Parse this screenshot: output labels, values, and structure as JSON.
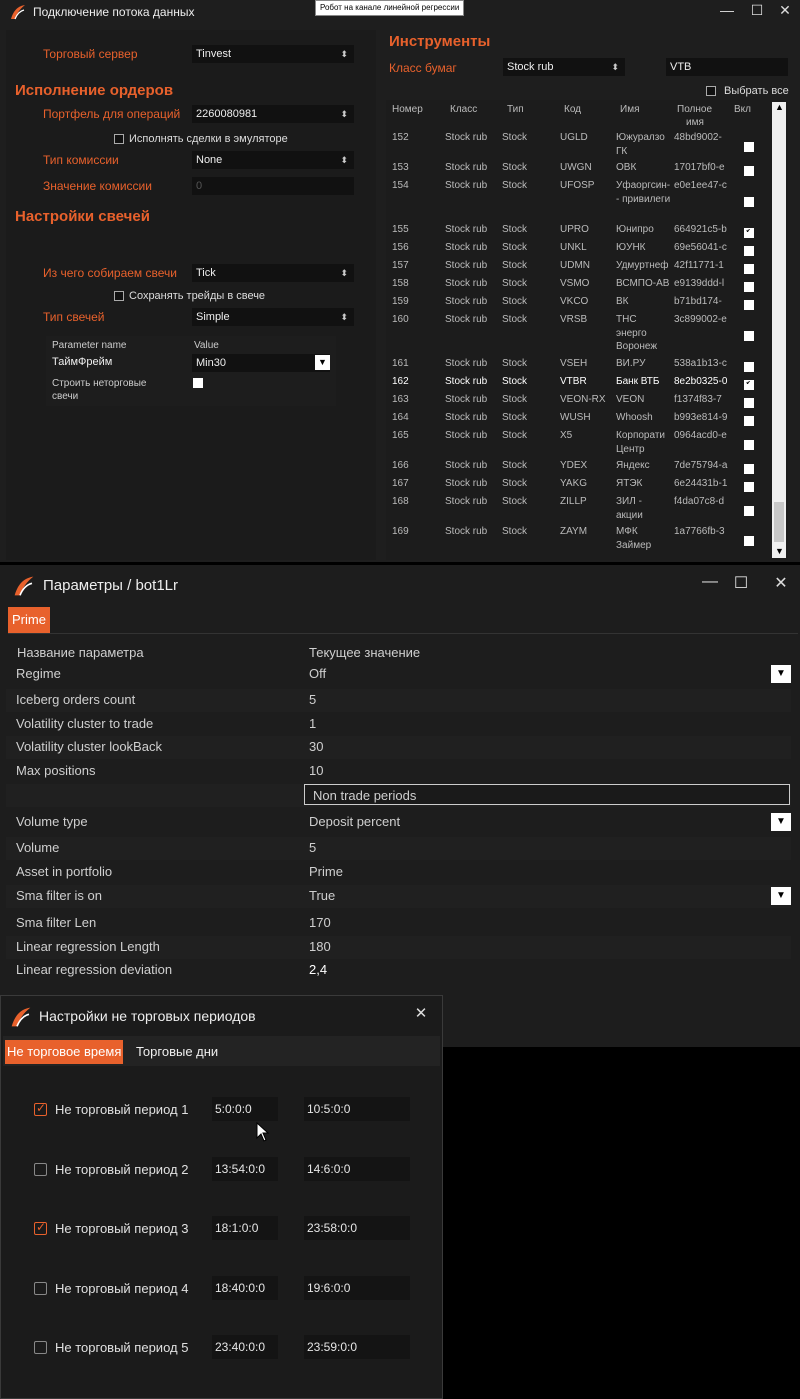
{
  "tooltip": "Робот на канале линейной регрессии",
  "conn": {
    "title": "Подключение потока данных",
    "server_label": "Торговый сервер",
    "server_value": "Tinvest",
    "orders_header": "Исполнение ордеров",
    "portfolio_label": "Портфель для операций",
    "portfolio_value": "2260080981",
    "emulator_label": "Исполнять сделки в эмуляторе",
    "commission_type_label": "Тип комиссии",
    "commission_type_value": "None",
    "commission_value_label": "Значение комиссии",
    "commission_value": "0",
    "candles_header": "Настройки свечей",
    "candles_source_label": "Из чего собираем свечи",
    "candles_source_value": "Tick",
    "save_trades_label": "Сохранять трейды в свече",
    "candle_type_label": "Тип свечей",
    "candle_type_value": "Simple",
    "param_col_name": "Parameter name",
    "param_col_value": "Value",
    "timeframe_label": "ТаймФрейм",
    "timeframe_value": "Min30",
    "nontrade_candles_label_1": "Строить неторговые",
    "nontrade_candles_label_2": "свечи",
    "instr_header": "Инструменты",
    "class_label": "Класс бумаг",
    "class_value": "Stock rub",
    "search_value": "VTB",
    "select_all_label": "Выбрать все",
    "cols": {
      "num": "Номер",
      "cls": "Класс",
      "type": "Тип",
      "code": "Код",
      "name": "Имя",
      "full1": "Полное",
      "full2": "имя",
      "on": "Вкл"
    },
    "rows": [
      {
        "num": "152",
        "cls": "Stock rub",
        "type": "Stock",
        "code": "UGLD",
        "name": "Южуралзо",
        "name2": "ГК",
        "full": "48bd9002-",
        "on": false
      },
      {
        "num": "153",
        "cls": "Stock rub",
        "type": "Stock",
        "code": "UWGN",
        "name": "ОВК",
        "name2": "",
        "full": "17017bf0-e",
        "on": false
      },
      {
        "num": "154",
        "cls": "Stock rub",
        "type": "Stock",
        "code": "UFOSP",
        "name": "Уфаоргсин-",
        "name2": "- привилеги",
        "full": "e0e1ee47-c",
        "on": false
      },
      {
        "num": "155",
        "cls": "Stock rub",
        "type": "Stock",
        "code": "UPRO",
        "name": "Юнипро",
        "name2": "",
        "full": "664921c5-b",
        "on": true
      },
      {
        "num": "156",
        "cls": "Stock rub",
        "type": "Stock",
        "code": "UNKL",
        "name": "ЮУНК",
        "name2": "",
        "full": "69e56041-c",
        "on": false
      },
      {
        "num": "157",
        "cls": "Stock rub",
        "type": "Stock",
        "code": "UDMN",
        "name": "Удмуртнеф",
        "name2": "",
        "full": "42f11771-1",
        "on": false
      },
      {
        "num": "158",
        "cls": "Stock rub",
        "type": "Stock",
        "code": "VSMO",
        "name": "ВСМПО-АВ",
        "name2": "",
        "full": "e9139ddd-l",
        "on": false
      },
      {
        "num": "159",
        "cls": "Stock rub",
        "type": "Stock",
        "code": "VKCO",
        "name": "ВК",
        "name2": "",
        "full": "b71bd174-",
        "on": false
      },
      {
        "num": "160",
        "cls": "Stock rub",
        "type": "Stock",
        "code": "VRSB",
        "name": "ТНС",
        "name2": "энерго Воронеж",
        "full": "3c899002-e",
        "on": false
      },
      {
        "num": "161",
        "cls": "Stock rub",
        "type": "Stock",
        "code": "VSEH",
        "name": "ВИ.РУ",
        "name2": "",
        "full": "538a1b13-c",
        "on": false
      },
      {
        "num": "162",
        "cls": "Stock rub",
        "type": "Stock",
        "code": "VTBR",
        "name": "Банк ВТБ",
        "name2": "",
        "full": "8e2b0325-0",
        "on": true
      },
      {
        "num": "163",
        "cls": "Stock rub",
        "type": "Stock",
        "code": "VEON-RX",
        "name": "VEON",
        "name2": "",
        "full": "f1374f83-7",
        "on": false
      },
      {
        "num": "164",
        "cls": "Stock rub",
        "type": "Stock",
        "code": "WUSH",
        "name": "Whoosh",
        "name2": "",
        "full": "b993e814-9",
        "on": false
      },
      {
        "num": "165",
        "cls": "Stock rub",
        "type": "Stock",
        "code": "X5",
        "name": "Корпорати",
        "name2": "Центр",
        "full": "0964acd0-e",
        "on": false
      },
      {
        "num": "166",
        "cls": "Stock rub",
        "type": "Stock",
        "code": "YDEX",
        "name": "Яндекс",
        "name2": "",
        "full": "7de75794-a",
        "on": false
      },
      {
        "num": "167",
        "cls": "Stock rub",
        "type": "Stock",
        "code": "YAKG",
        "name": "ЯТЭК",
        "name2": "",
        "full": "6e24431b-1",
        "on": false
      },
      {
        "num": "168",
        "cls": "Stock rub",
        "type": "Stock",
        "code": "ZILLP",
        "name": "ЗИЛ -",
        "name2": "акции",
        "full": "f4da07c8-d",
        "on": false
      },
      {
        "num": "169",
        "cls": "Stock rub",
        "type": "Stock",
        "code": "ZAYM",
        "name": "МФК",
        "name2": "Займер",
        "full": "1a7766fb-3",
        "on": false
      }
    ]
  },
  "params": {
    "title": "Параметры / bot1Lr",
    "tab": "Prime",
    "col_name": "Название параметра",
    "col_value": "Текущее значение",
    "rows": [
      {
        "name": "Regime",
        "value": "Off",
        "dropdown": true
      },
      {
        "name": "Iceberg orders count",
        "value": "5",
        "dropdown": false
      },
      {
        "name": "Volatility cluster to trade",
        "value": "1",
        "dropdown": false
      },
      {
        "name": "Volatility cluster lookBack",
        "value": "30",
        "dropdown": false
      },
      {
        "name": "Max positions",
        "value": "10",
        "dropdown": false
      },
      {
        "name": "",
        "value": "Non trade periods",
        "button": true
      },
      {
        "name": "Volume type",
        "value": "Deposit percent",
        "dropdown": true
      },
      {
        "name": "Volume",
        "value": "5",
        "dropdown": false
      },
      {
        "name": "Asset in portfolio",
        "value": "Prime",
        "dropdown": false
      },
      {
        "name": "Sma filter is on",
        "value": "True",
        "dropdown": true
      },
      {
        "name": "Sma filter Len",
        "value": "170",
        "dropdown": false
      },
      {
        "name": "Linear regression Length",
        "value": "180",
        "dropdown": false
      },
      {
        "name": "Linear regression deviation",
        "value": "2,4",
        "dropdown": false
      }
    ]
  },
  "ntp": {
    "title": "Настройки не торговых периодов",
    "tab_time": "Не торговое время",
    "tab_days": "Торговые дни",
    "rows": [
      {
        "label": "Не торговый период 1",
        "on": true,
        "start": "5:0:0:0",
        "end": "10:5:0:0"
      },
      {
        "label": "Не торговый период 2",
        "on": false,
        "start": "13:54:0:0",
        "end": "14:6:0:0"
      },
      {
        "label": "Не торговый период 3",
        "on": true,
        "start": "18:1:0:0",
        "end": "23:58:0:0"
      },
      {
        "label": "Не торговый период 4",
        "on": false,
        "start": "18:40:0:0",
        "end": "19:6:0:0"
      },
      {
        "label": "Не торговый период 5",
        "on": false,
        "start": "23:40:0:0",
        "end": "23:59:0:0"
      }
    ]
  },
  "colors": {
    "accent": "#e8612c",
    "bg": "#1b1b1b",
    "field": "#111111"
  }
}
